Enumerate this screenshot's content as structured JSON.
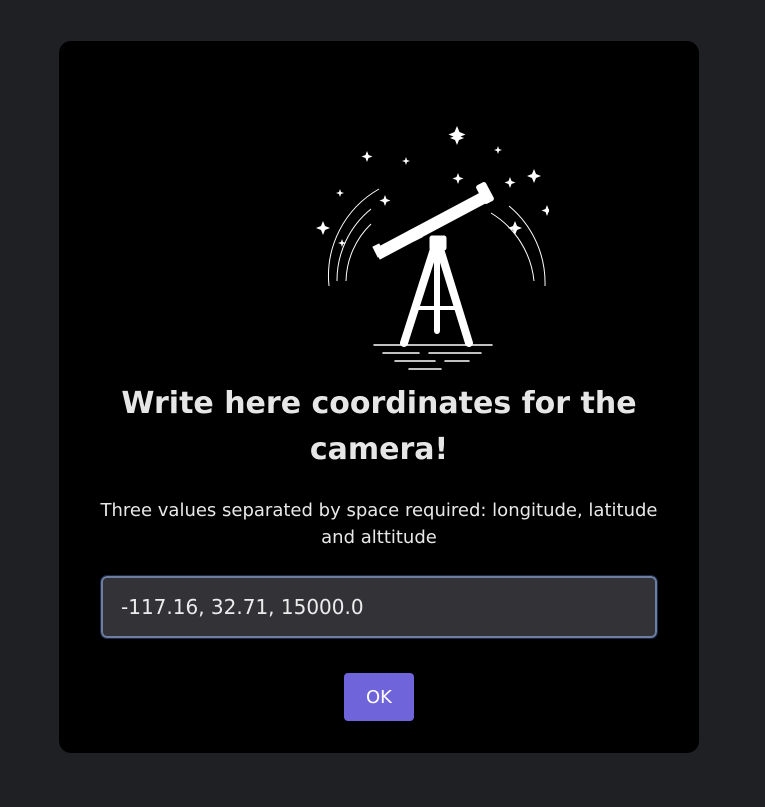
{
  "dialog": {
    "illustration_icon": "telescope-icon",
    "title": "Write here coordinates for the camera!",
    "subtitle": "Three values separated by space required: longitude, latitude and alttitude",
    "input": {
      "value": "-117.16, 32.71, 15000.0",
      "placeholder": ""
    },
    "ok_label": "OK"
  },
  "colors": {
    "page_background": "#1f2023",
    "dialog_background": "#000000",
    "accent": "#7064db",
    "input_background": "#333337",
    "input_border": "#6d7ea1"
  }
}
